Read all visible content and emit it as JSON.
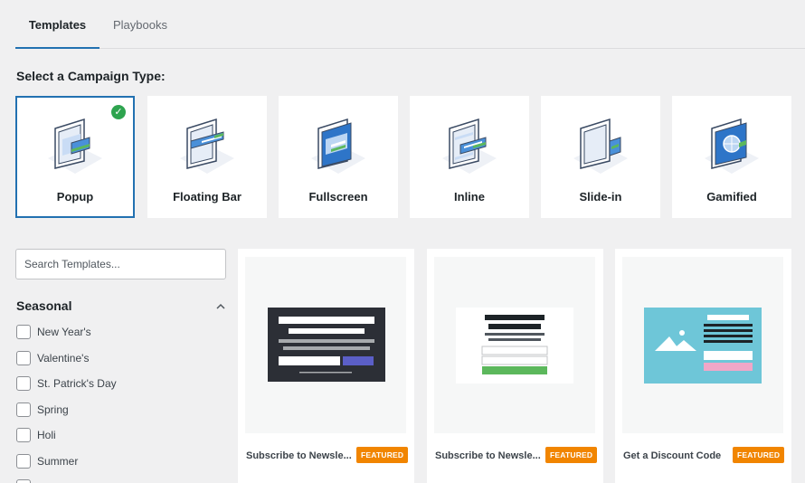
{
  "tabs": [
    {
      "label": "Templates",
      "active": true
    },
    {
      "label": "Playbooks",
      "active": false
    }
  ],
  "campaign_section": {
    "title": "Select a Campaign Type:",
    "types": [
      {
        "label": "Popup",
        "selected": true,
        "icon": "popup-icon"
      },
      {
        "label": "Floating Bar",
        "selected": false,
        "icon": "floating-bar-icon"
      },
      {
        "label": "Fullscreen",
        "selected": false,
        "icon": "fullscreen-icon"
      },
      {
        "label": "Inline",
        "selected": false,
        "icon": "inline-icon"
      },
      {
        "label": "Slide-in",
        "selected": false,
        "icon": "slide-in-icon"
      },
      {
        "label": "Gamified",
        "selected": false,
        "icon": "gamified-icon"
      }
    ],
    "check_glyph": "✓"
  },
  "search": {
    "placeholder": "Search Templates..."
  },
  "filters": {
    "title": "Seasonal",
    "items": [
      "New Year's",
      "Valentine's",
      "St. Patrick's Day",
      "Spring",
      "Holi",
      "Summer"
    ]
  },
  "templates": [
    {
      "title": "Subscribe to Newsle...",
      "badge": "FEATURED"
    },
    {
      "title": "Subscribe to Newsle...",
      "badge": "FEATURED"
    },
    {
      "title": "Get a Discount Code",
      "badge": "FEATURED"
    }
  ],
  "colors": {
    "accent": "#2271b1",
    "check": "#2ea44f",
    "badge": "#f18500",
    "green": "#5cb85c",
    "teal": "#6ec6d8",
    "pink": "#f0a7c8",
    "purple": "#5b5fc7",
    "dark": "#2c2f36"
  }
}
